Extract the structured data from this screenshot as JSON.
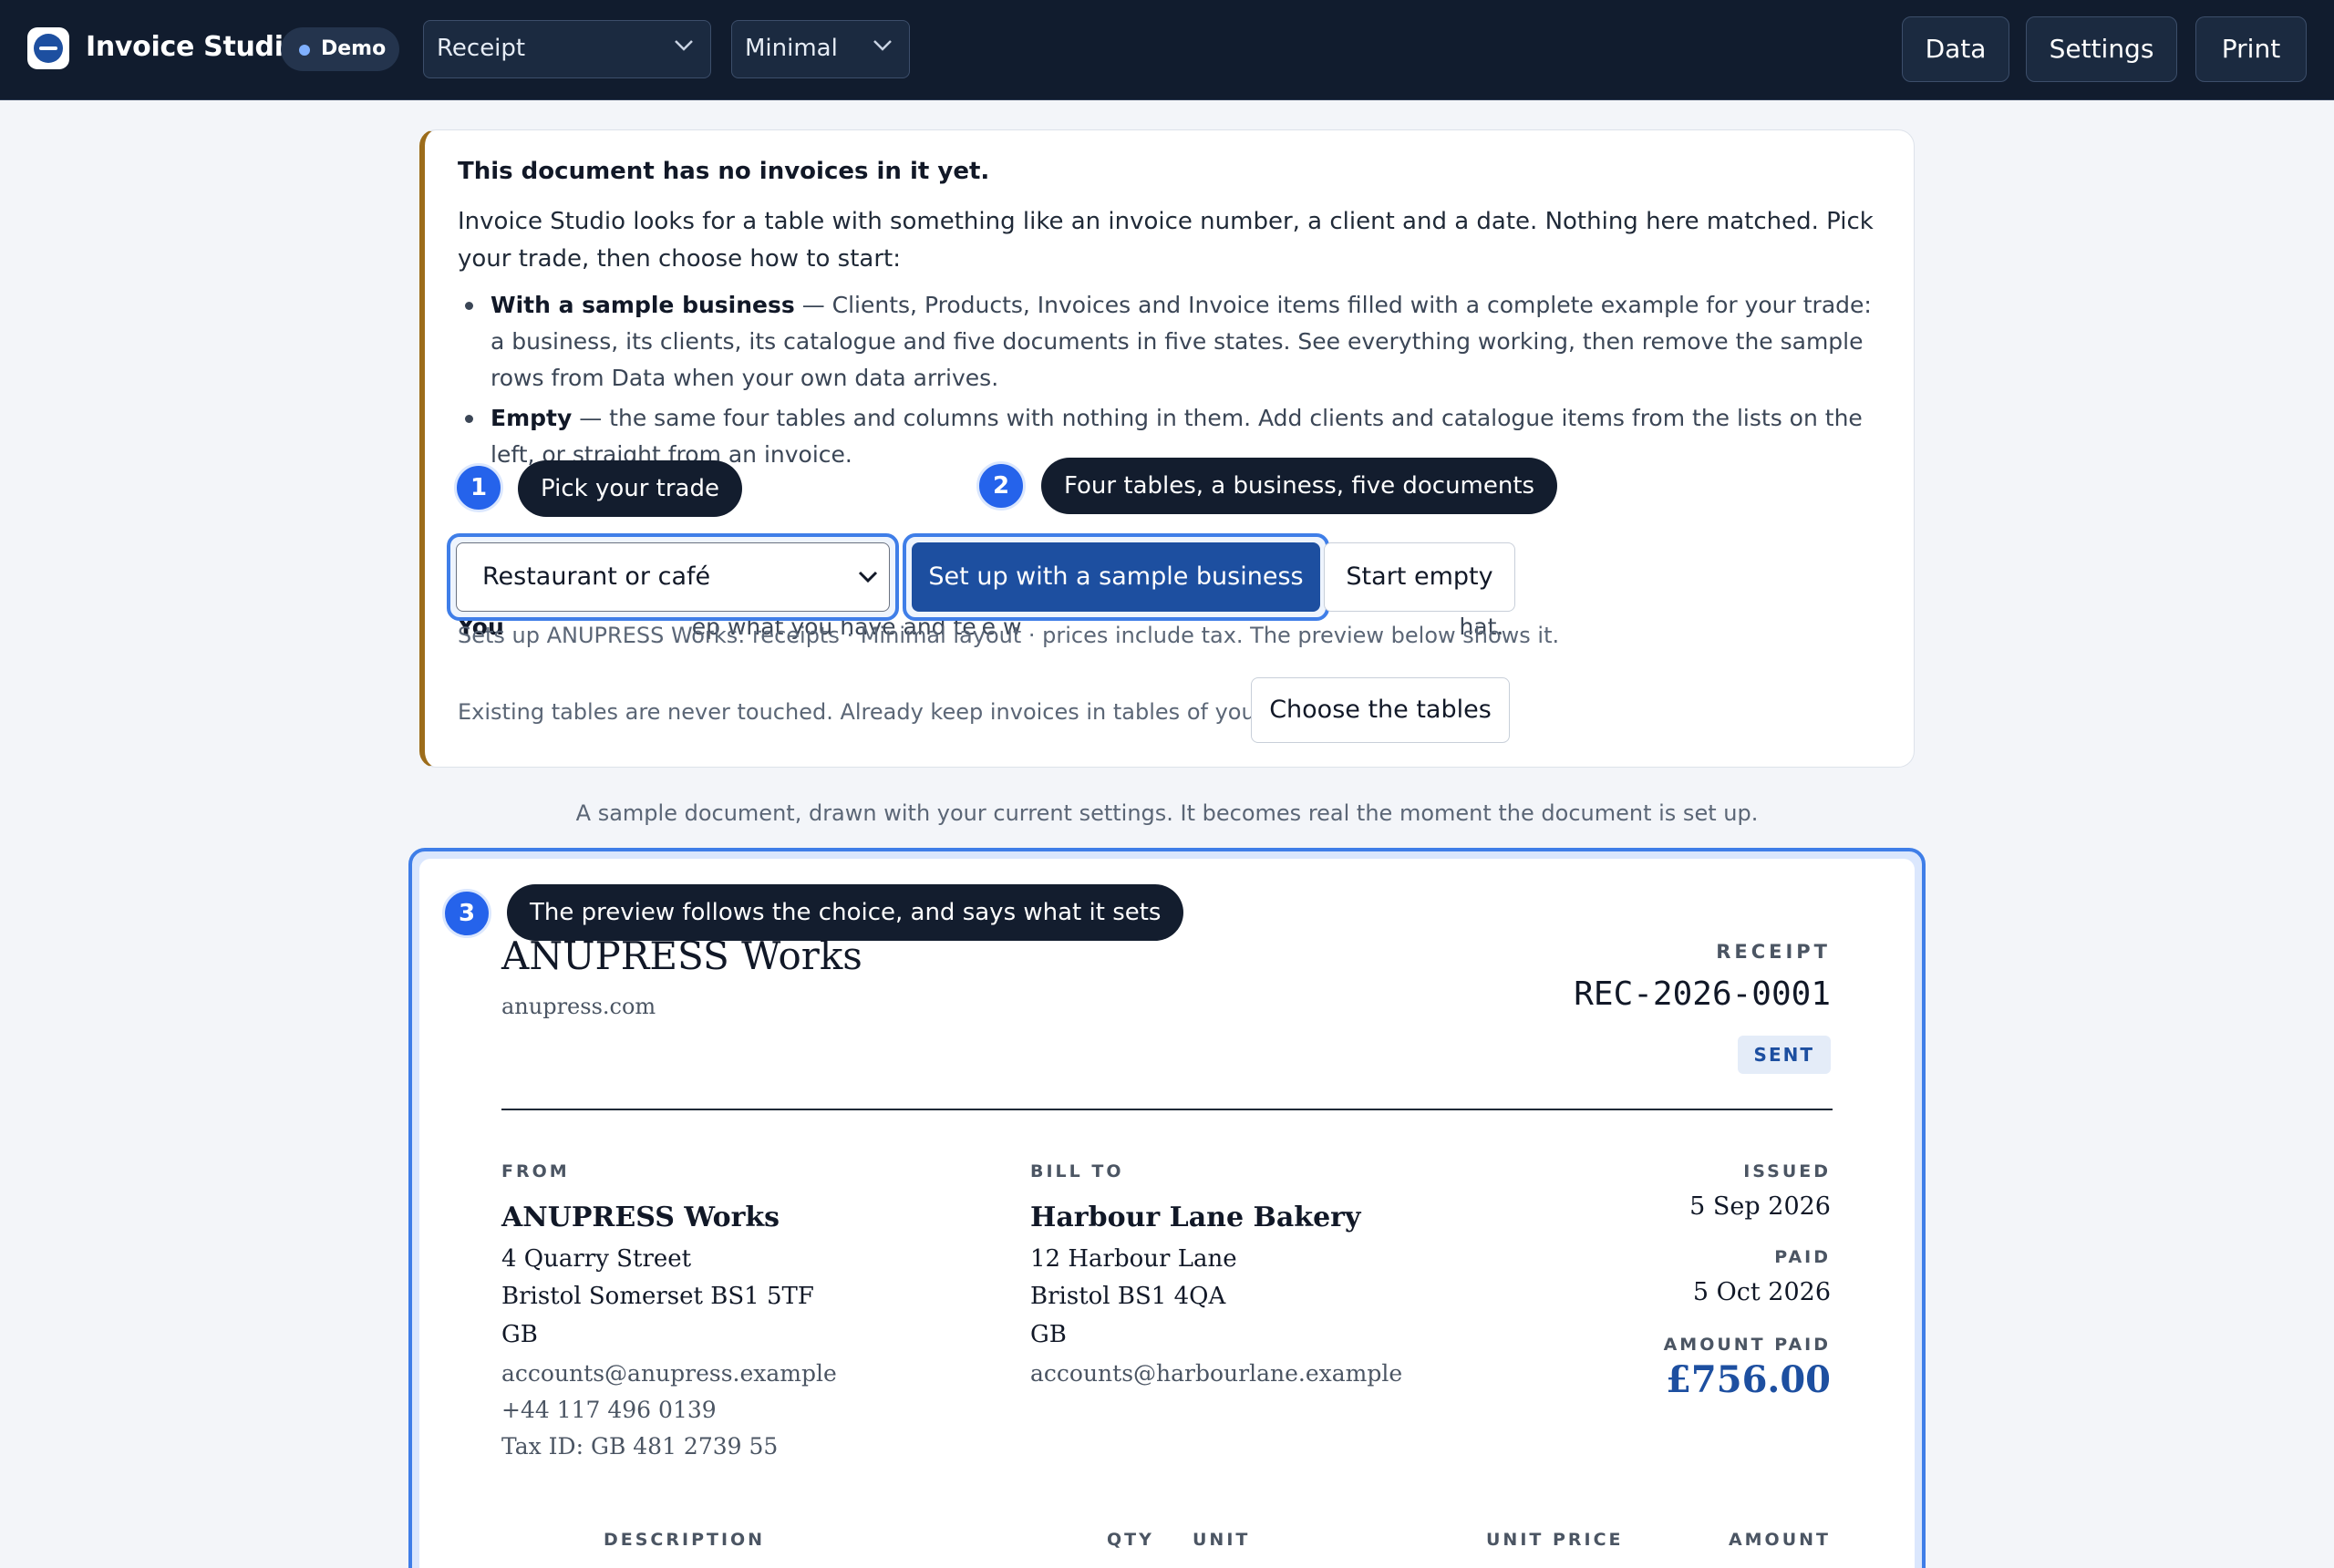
{
  "app": {
    "title": "Invoice Studio",
    "badge": "Demo",
    "document_type": "Receipt",
    "layout": "Minimal",
    "buttons": {
      "data": "Data",
      "settings": "Settings",
      "print": "Print"
    }
  },
  "onboarding": {
    "title": "This document has no invoices in it yet.",
    "intro": "Invoice Studio looks for a table with something like an invoice number, a client and a date. Nothing here matched. Pick your trade, then choose how to start:",
    "options": [
      {
        "label": "With a sample business",
        "text": " — Clients, Products, Invoices and Invoice items filled with a complete example for your trade: a business, its clients, its catalogue and five documents in five states. See everything working, then remove the sample rows from Data when your own data arrives."
      },
      {
        "label": "Empty",
        "text": " — the same four tables and columns with nothing in them. Add clients and catalogue items from the lists on the left, or straight from an invoice."
      }
    ],
    "line3_prefix": "You",
    "line3_mid": "ep what you have and te",
    "line3_mid2": "e w",
    "line3_end": "hat.",
    "trade_value": "Restaurant or café",
    "sample_button": "Set up with a sample business",
    "empty_button": "Start empty",
    "hint": "Sets up ANUPRESS Works: receipts · Minimal layout · prices include tax. The preview below shows it.",
    "existing_text": "Existing tables are never touched. Already keep invoices in tables of your own?",
    "choose_button": "Choose the tables"
  },
  "tour": [
    {
      "num": "1",
      "text": "Pick your trade"
    },
    {
      "num": "2",
      "text": "Four tables, a business, five documents"
    },
    {
      "num": "3",
      "text": "The preview follows the choice, and says what it sets"
    }
  ],
  "sample_caption": "A sample document, drawn with your current settings. It becomes real the moment the document is set up.",
  "preview": {
    "business_name": "ANUPRESS Works",
    "website": "anupress.com",
    "doc_kind": "RECEIPT",
    "doc_number": "REC-2026-0001",
    "status": "SENT",
    "from_label": "FROM",
    "from": {
      "name": "ANUPRESS Works",
      "street": "4 Quarry Street",
      "city": "Bristol Somerset BS1 5TF",
      "country": "GB",
      "email": "accounts@anupress.example",
      "phone": "+44 117 496 0139",
      "tax_id": "Tax ID: GB 481 2739 55"
    },
    "bill_to_label": "BILL TO",
    "bill_to": {
      "name": "Harbour Lane Bakery",
      "street": "12 Harbour Lane",
      "city": "Bristol BS1 4QA",
      "country": "GB",
      "email": "accounts@harbourlane.example"
    },
    "issued_label": "ISSUED",
    "issued": "5 Sep 2026",
    "paid_label": "PAID",
    "paid": "5 Oct 2026",
    "amount_label": "AMOUNT PAID",
    "amount": "£756.00",
    "columns": [
      "DESCRIPTION",
      "QTY",
      "UNIT",
      "UNIT PRICE",
      "AMOUNT"
    ]
  },
  "colors": {
    "topbar": "#111c2e",
    "accent": "#2563eb",
    "primary_button": "#1d4fa0",
    "card_stripe": "#9c6c1a"
  }
}
